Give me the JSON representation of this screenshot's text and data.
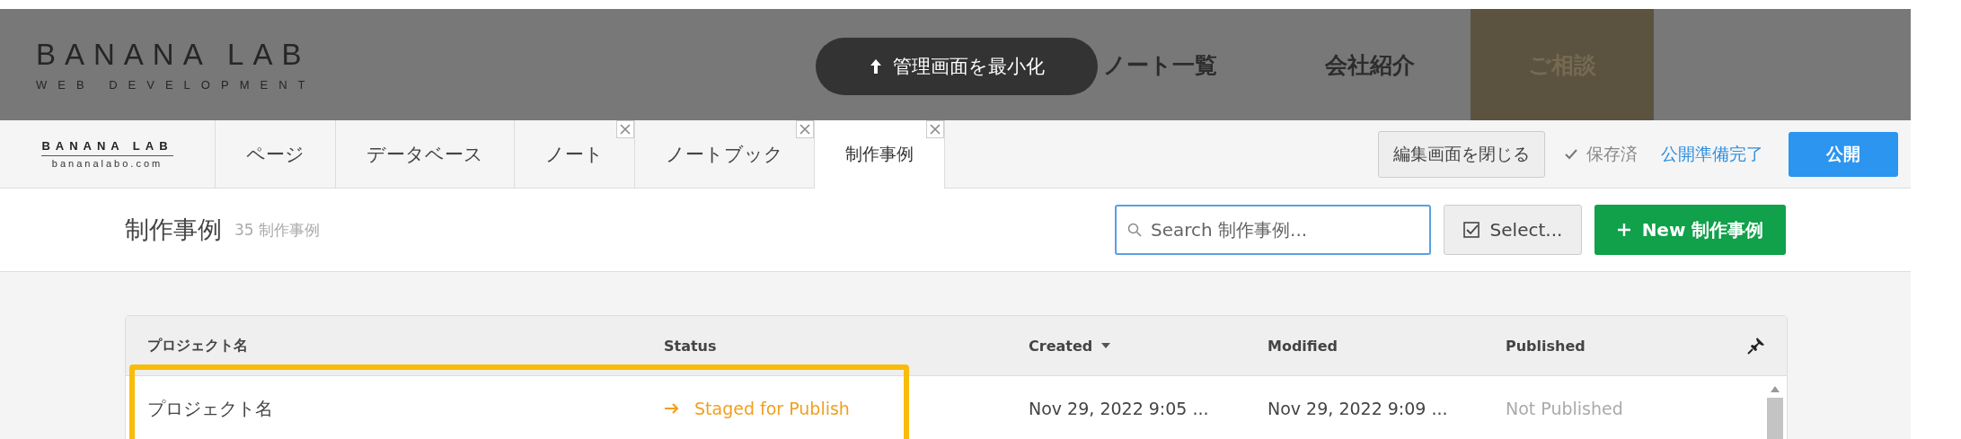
{
  "site_header": {
    "logo_title": "BANANA LAB",
    "logo_subtitle": "WEB DEVELOPMENT",
    "minimize_button": "管理画面を最小化",
    "nav": [
      {
        "label": "ノート一覧",
        "highlighted": false
      },
      {
        "label": "会社紹介",
        "highlighted": false
      },
      {
        "label": "ご相談",
        "highlighted": true
      }
    ]
  },
  "editor_tabs": {
    "logo_title": "BANANA LAB",
    "logo_subtitle": "bananalabo.com",
    "items": [
      {
        "label": "ページ",
        "selected": false,
        "closable": false
      },
      {
        "label": "データベース",
        "selected": false,
        "closable": false
      },
      {
        "label": "ノート",
        "selected": false,
        "closable": true
      },
      {
        "label": "ノートブック",
        "selected": false,
        "closable": true
      },
      {
        "label": "制作事例",
        "selected": true,
        "closable": true
      }
    ]
  },
  "toolbar": {
    "close_editor": "編集画面を閉じる",
    "saved": "保存済",
    "staged_link": "公開準備完了",
    "publish": "公開"
  },
  "page": {
    "title": "制作事例",
    "count": "35 制作事例",
    "search": {
      "placeholder": "Search 制作事例..."
    },
    "select_button": "Select...",
    "new_button": "New 制作事例"
  },
  "table": {
    "columns": [
      {
        "label": "プロジェクト名",
        "sorted": false
      },
      {
        "label": "Status",
        "sorted": false
      },
      {
        "label": "Created",
        "sorted": true
      },
      {
        "label": "Modified",
        "sorted": false
      },
      {
        "label": "Published",
        "sorted": false
      }
    ],
    "rows": [
      {
        "name": "プロジェクト名",
        "status": "Staged for Publish",
        "color": "#f0a020",
        "created": "Nov 29, 2022 9:05 ...",
        "modified": "Nov 29, 2022 9:09 ...",
        "published": "Not Published",
        "is_published": false,
        "highlighted": true
      }
    ]
  }
}
